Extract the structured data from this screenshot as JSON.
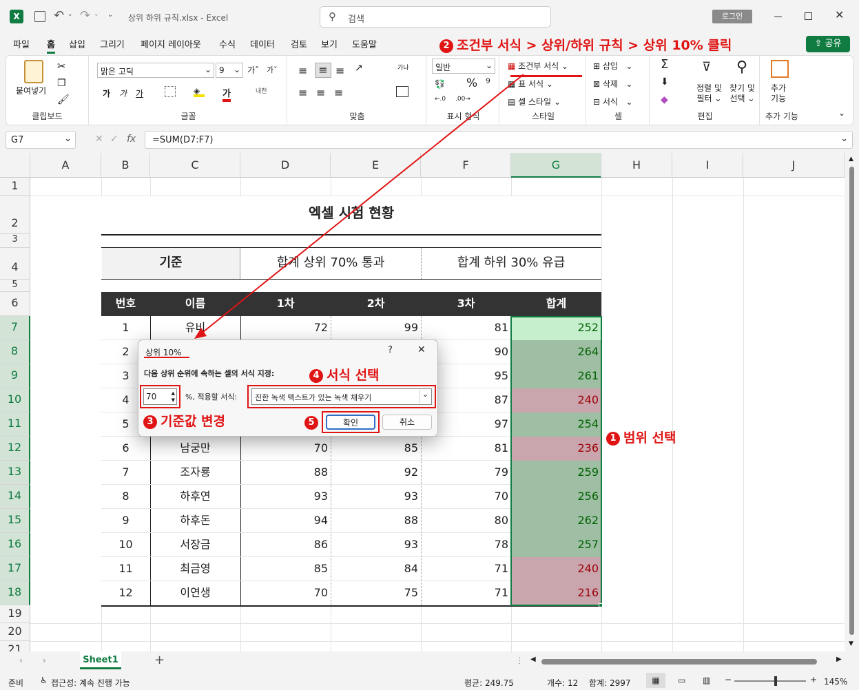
{
  "titlebar": {
    "filename": "상위 하위 규칙.xlsx",
    "app": "Excel",
    "search": "검색",
    "login": "로그인"
  },
  "tabs": [
    "파일",
    "홈",
    "삽입",
    "그리기",
    "페이지 레이아웃",
    "수식",
    "데이터",
    "검토",
    "보기",
    "도움말"
  ],
  "share": "공유",
  "ribbon": {
    "clipboard": {
      "paste": "붙여넣기",
      "label": "클립보드"
    },
    "font": {
      "name": "맑은 고딕",
      "size": "9",
      "label": "글꼴"
    },
    "align": {
      "label": "맞춤"
    },
    "number": {
      "format": "일반",
      "label": "표시 형식"
    },
    "styles": {
      "cond": "조건부 서식",
      "table": "표 서식",
      "cell": "셀 스타일",
      "label": "스타일"
    },
    "cells": {
      "insert": "삽입",
      "delete": "삭제",
      "format": "서식",
      "label": "셀"
    },
    "edit": {
      "sort1": "정렬 및",
      "sort2": "필터",
      "find1": "찾기 및",
      "find2": "선택",
      "label": "편집"
    },
    "addins": {
      "l1": "추가",
      "l2": "기능",
      "label": "추가 기능"
    }
  },
  "formula_bar": {
    "name_box": "G7",
    "fx": "fx",
    "formula": "=SUM(D7:F7)"
  },
  "columns": [
    "A",
    "B",
    "C",
    "D",
    "E",
    "F",
    "G",
    "H",
    "I",
    "J"
  ],
  "rows": [
    "1",
    "2",
    "3",
    "4",
    "5",
    "6",
    "7",
    "8",
    "9",
    "10",
    "11",
    "12",
    "13",
    "14",
    "15",
    "16",
    "17",
    "18",
    "19",
    "20",
    "21"
  ],
  "sheet_title": "엑셀 시험 현황",
  "criteria": {
    "label": "기준",
    "upper": "합계 상위 70% 통과",
    "lower": "합계 하위 30% 유급"
  },
  "headers": [
    "번호",
    "이름",
    "1차",
    "2차",
    "3차",
    "합계"
  ],
  "data": [
    [
      "1",
      "유비",
      "72",
      "99",
      "81",
      "252"
    ],
    [
      "2",
      "",
      "",
      "",
      "90",
      "264"
    ],
    [
      "3",
      "",
      "",
      "",
      "95",
      "261"
    ],
    [
      "4",
      "",
      "",
      "",
      "87",
      "240"
    ],
    [
      "5",
      "",
      "",
      "",
      "97",
      "254"
    ],
    [
      "6",
      "남궁만",
      "70",
      "85",
      "81",
      "236"
    ],
    [
      "7",
      "조자룡",
      "88",
      "92",
      "79",
      "259"
    ],
    [
      "8",
      "하후연",
      "93",
      "93",
      "70",
      "256"
    ],
    [
      "9",
      "하후돈",
      "94",
      "88",
      "80",
      "262"
    ],
    [
      "10",
      "서장금",
      "86",
      "93",
      "78",
      "257"
    ],
    [
      "11",
      "최금영",
      "85",
      "84",
      "71",
      "240"
    ],
    [
      "12",
      "이연생",
      "70",
      "75",
      "71",
      "216"
    ]
  ],
  "dialog": {
    "title": "상위 10%",
    "help": "?",
    "close": "✕",
    "instruction": "다음 상위 순위에 속하는 셀의 서식 지정:",
    "value": "70",
    "mid": "%, 적용할 서식:",
    "format": "진한 녹색 텍스트가 있는 녹색 채우기",
    "ok": "확인",
    "cancel": "취소"
  },
  "annotations": {
    "a1": {
      "num": "1",
      "text": "범위 선택"
    },
    "a2": {
      "num": "2",
      "text": "조건부 서식 > 상위/하위 규칙 > 상위 10% 클릭"
    },
    "a3": {
      "num": "3",
      "text": "기준값 변경"
    },
    "a4": {
      "num": "4",
      "text": "서식 선택"
    },
    "a5": {
      "num": "5"
    }
  },
  "sheet_tab": "Sheet1",
  "status": {
    "ready": "준비",
    "access": "접근성: 계속 진행 가능",
    "avg": "평균: 249.75",
    "count": "개수: 12",
    "sum": "합계: 2997",
    "zoom": "145%"
  },
  "colors": {
    "green_fill": "#c6efce",
    "green_text": "#006100",
    "selected_green": "#9fbfa5",
    "red_sel": "#c9a6ad",
    "red_text": "#9c0006",
    "header_dark": "#333333",
    "excel_green": "#107c41",
    "annot_red": "#e01414"
  }
}
